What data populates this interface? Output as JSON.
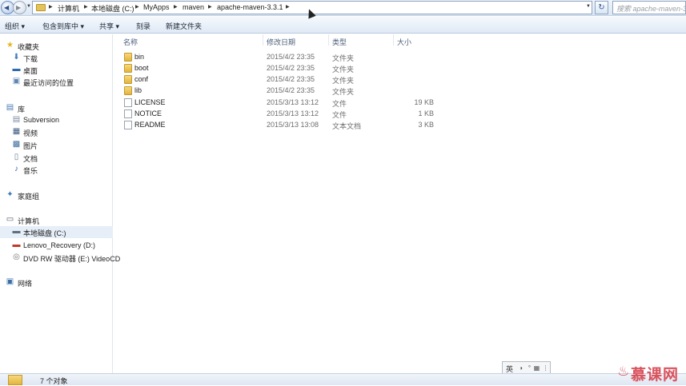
{
  "address_bar": {
    "crumbs": [
      "计算机",
      "本地磁盘 (C:)",
      "MyApps",
      "maven",
      "apache-maven-3.3.1"
    ],
    "search_placeholder": "搜索 apache-maven-3..."
  },
  "toolbar": {
    "organize": "组织 ▾",
    "include_in_library": "包含到库中 ▾",
    "share": "共享 ▾",
    "burn": "刻录",
    "new_folder": "新建文件夹"
  },
  "nav": {
    "favorites": "收藏夹",
    "downloads": "下载",
    "desktop": "桌面",
    "recent": "最近访问的位置",
    "libraries": "库",
    "subversion": "Subversion",
    "videos": "视频",
    "pictures": "图片",
    "documents": "文档",
    "music": "音乐",
    "homegroup": "家庭组",
    "computer": "计算机",
    "drive_c": "本地磁盘 (C:)",
    "drive_d": "Lenovo_Recovery (D:)",
    "drive_e": "DVD RW 驱动器 (E:) VideoCD",
    "network": "网络"
  },
  "columns": {
    "name": "名称",
    "modified": "修改日期",
    "type": "类型",
    "size": "大小"
  },
  "files": [
    {
      "name": "bin",
      "modified": "2015/4/2 23:35",
      "type": "文件夹",
      "size": "",
      "kind": "folder"
    },
    {
      "name": "boot",
      "modified": "2015/4/2 23:35",
      "type": "文件夹",
      "size": "",
      "kind": "folder"
    },
    {
      "name": "conf",
      "modified": "2015/4/2 23:35",
      "type": "文件夹",
      "size": "",
      "kind": "folder"
    },
    {
      "name": "lib",
      "modified": "2015/4/2 23:35",
      "type": "文件夹",
      "size": "",
      "kind": "folder"
    },
    {
      "name": "LICENSE",
      "modified": "2015/3/13 13:12",
      "type": "文件",
      "size": "19 KB",
      "kind": "file"
    },
    {
      "name": "NOTICE",
      "modified": "2015/3/13 13:12",
      "type": "文件",
      "size": "1 KB",
      "kind": "file"
    },
    {
      "name": "README",
      "modified": "2015/3/13 13:08",
      "type": "文本文档",
      "size": "3 KB",
      "kind": "file"
    }
  ],
  "status": {
    "item_count": "7 个对象"
  },
  "ime": {
    "lang": "英"
  },
  "watermark": {
    "text": "慕课网"
  }
}
